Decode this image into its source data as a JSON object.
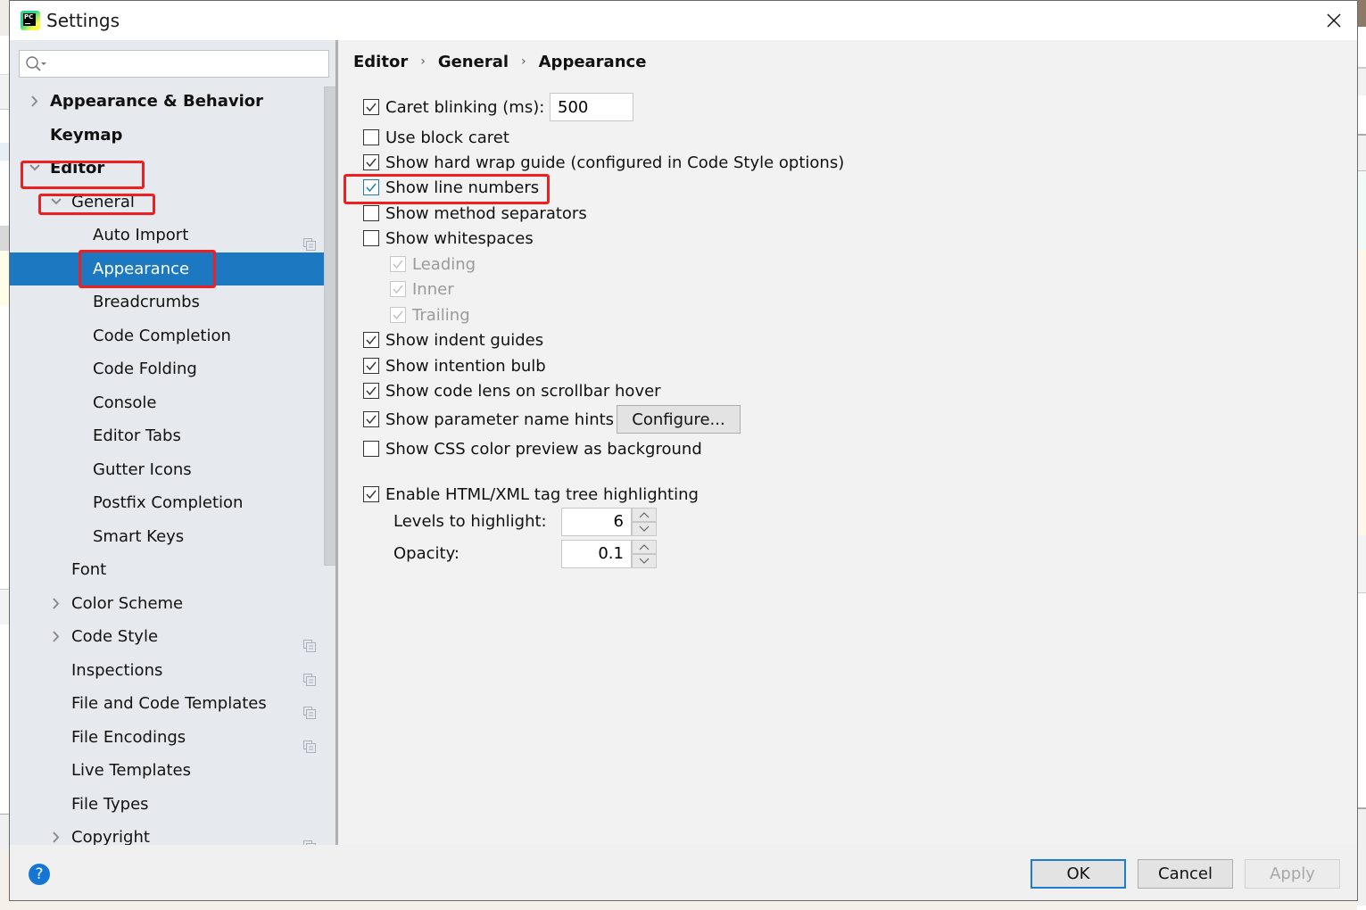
{
  "window": {
    "title": "Settings",
    "app_icon": "pycharm-icon",
    "close_icon": "close-icon"
  },
  "sidebar": {
    "search": {
      "value": "",
      "placeholder": "",
      "icon": "search-icon"
    },
    "items": [
      {
        "label": "Appearance & Behavior",
        "level": 0,
        "bold": true,
        "arrow": "collapsed"
      },
      {
        "label": "Keymap",
        "level": 0,
        "bold": true,
        "arrow": "none"
      },
      {
        "label": "Editor",
        "level": 0,
        "bold": true,
        "arrow": "expanded",
        "highlighted": true
      },
      {
        "label": "General",
        "level": 1,
        "arrow": "expanded",
        "highlighted": true
      },
      {
        "label": "Auto Import",
        "level": 2,
        "project_icon": true
      },
      {
        "label": "Appearance",
        "level": 2,
        "selected": true,
        "highlighted": true
      },
      {
        "label": "Breadcrumbs",
        "level": 2
      },
      {
        "label": "Code Completion",
        "level": 2
      },
      {
        "label": "Code Folding",
        "level": 2
      },
      {
        "label": "Console",
        "level": 2
      },
      {
        "label": "Editor Tabs",
        "level": 2
      },
      {
        "label": "Gutter Icons",
        "level": 2
      },
      {
        "label": "Postfix Completion",
        "level": 2
      },
      {
        "label": "Smart Keys",
        "level": 2
      },
      {
        "label": "Font",
        "level": 1
      },
      {
        "label": "Color Scheme",
        "level": 1,
        "arrow": "collapsed"
      },
      {
        "label": "Code Style",
        "level": 1,
        "arrow": "collapsed",
        "project_icon": true
      },
      {
        "label": "Inspections",
        "level": 1,
        "project_icon": true
      },
      {
        "label": "File and Code Templates",
        "level": 1,
        "project_icon": true
      },
      {
        "label": "File Encodings",
        "level": 1,
        "project_icon": true
      },
      {
        "label": "Live Templates",
        "level": 1
      },
      {
        "label": "File Types",
        "level": 1
      },
      {
        "label": "Copyright",
        "level": 1,
        "arrow": "collapsed",
        "project_icon": true
      }
    ]
  },
  "content": {
    "breadcrumb": [
      "Editor",
      "General",
      "Appearance"
    ],
    "options": [
      {
        "label": "Caret blinking (ms):",
        "checked": true,
        "field_value": "500"
      },
      {
        "label": "Use block caret",
        "checked": false
      },
      {
        "label": "Show hard wrap guide (configured in Code Style options)",
        "checked": true
      },
      {
        "label": "Show line numbers",
        "checked": true,
        "highlighted": true
      },
      {
        "label": "Show method separators",
        "checked": false
      },
      {
        "label": "Show whitespaces",
        "checked": false
      },
      {
        "label": "Leading",
        "checked": true,
        "disabled": true
      },
      {
        "label": "Inner",
        "checked": true,
        "disabled": true
      },
      {
        "label": "Trailing",
        "checked": true,
        "disabled": true
      },
      {
        "label": "Show indent guides",
        "checked": true
      },
      {
        "label": "Show intention bulb",
        "checked": true
      },
      {
        "label": "Show code lens on scrollbar hover",
        "checked": true
      },
      {
        "label": "Show parameter name hints",
        "checked": true,
        "button": "Configure..."
      },
      {
        "label": "Show CSS color preview as background",
        "checked": false
      },
      {
        "label": "Enable HTML/XML tag tree highlighting",
        "checked": true
      }
    ],
    "levels": {
      "label": "Levels to highlight:",
      "value": "6"
    },
    "opacity": {
      "label": "Opacity:",
      "value": "0.1"
    }
  },
  "footer": {
    "help_icon": "help-icon",
    "help_label": "?",
    "ok": "OK",
    "cancel": "Cancel",
    "apply": "Apply"
  },
  "colors": {
    "selection": "#1c78c0",
    "annotation": "#f01f1f",
    "sidebar_bg": "#e6eaef",
    "dialog_bg": "#f2f2f2"
  }
}
